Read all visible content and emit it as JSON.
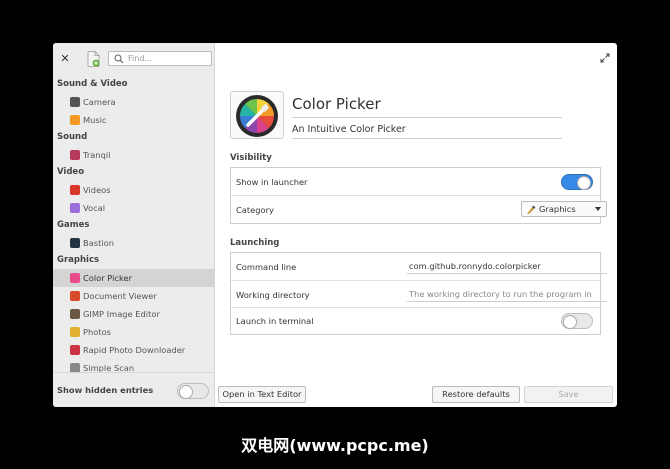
{
  "sidebar": {
    "search_placeholder": "Find...",
    "categories": [
      {
        "label": "Sound & Video",
        "items": [
          {
            "label": "Camera",
            "icon": "camera-icon",
            "color": "#555555"
          },
          {
            "label": "Music",
            "icon": "music-icon",
            "color": "#f29a21"
          }
        ]
      },
      {
        "label": "Sound",
        "items": [
          {
            "label": "Tranqil",
            "icon": "tranqil-icon",
            "color": "#b33a5a"
          }
        ]
      },
      {
        "label": "Video",
        "items": [
          {
            "label": "Videos",
            "icon": "videos-icon",
            "color": "#d9362b"
          },
          {
            "label": "Vocal",
            "icon": "vocal-icon",
            "color": "#9a6ed8"
          }
        ]
      },
      {
        "label": "Games",
        "items": [
          {
            "label": "Bastion",
            "icon": "bastion-icon",
            "color": "#223344"
          }
        ]
      },
      {
        "label": "Graphics",
        "items": [
          {
            "label": "Color Picker",
            "icon": "color-picker-icon",
            "color": "#e84a8a",
            "selected": true
          },
          {
            "label": "Document Viewer",
            "icon": "document-viewer-icon",
            "color": "#d94a2c"
          },
          {
            "label": "GIMP Image Editor",
            "icon": "gimp-icon",
            "color": "#6a5a44"
          },
          {
            "label": "Photos",
            "icon": "photos-icon",
            "color": "#e0b030"
          },
          {
            "label": "Rapid Photo Downloader",
            "icon": "rapid-photo-downloader-icon",
            "color": "#cc3344"
          },
          {
            "label": "Simple Scan",
            "icon": "simple-scan-icon",
            "color": "#888888"
          }
        ]
      }
    ],
    "show_hidden_label": "Show hidden entries",
    "show_hidden": false
  },
  "app": {
    "name": "Color Picker",
    "comment": "An Intuitive Color Picker"
  },
  "visibility": {
    "title": "Visibility",
    "show_in_launcher_label": "Show in launcher",
    "show_in_launcher": true,
    "category_label": "Category",
    "category_value": "Graphics"
  },
  "launching": {
    "title": "Launching",
    "command_label": "Command line",
    "command_value": "com.github.ronnydo.colorpicker",
    "workdir_label": "Working directory",
    "workdir_placeholder": "The working directory to run the program in",
    "terminal_label": "Launch in terminal",
    "terminal": false
  },
  "buttons": {
    "open_text_editor": "Open in Text Editor",
    "restore_defaults": "Restore defaults",
    "save": "Save"
  },
  "watermark": "双电网(www.pcpc.me)",
  "colors": {
    "accent": "#3689e6",
    "selection": "#d4d4d4",
    "sidebar_bg": "#ececec"
  }
}
